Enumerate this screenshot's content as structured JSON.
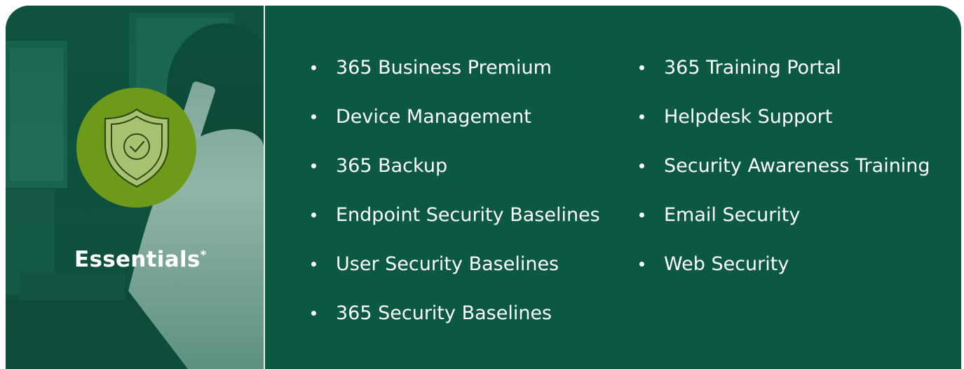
{
  "plan": {
    "name": "Essentials",
    "marker": "*",
    "icon": "shield-check-icon"
  },
  "features": {
    "column_1": [
      "365 Business Premium",
      "Device Management",
      "365 Backup",
      "Endpoint Security Baselines",
      "User Security Baselines",
      "365 Security Baselines"
    ],
    "column_2": [
      "365 Training Portal",
      "Helpdesk Support",
      "Security Awareness Training",
      "Email Security",
      "Web Security"
    ]
  },
  "colors": {
    "panel_background": "#0b5843",
    "badge": "#6e9a1a",
    "text": "#ffffff"
  }
}
